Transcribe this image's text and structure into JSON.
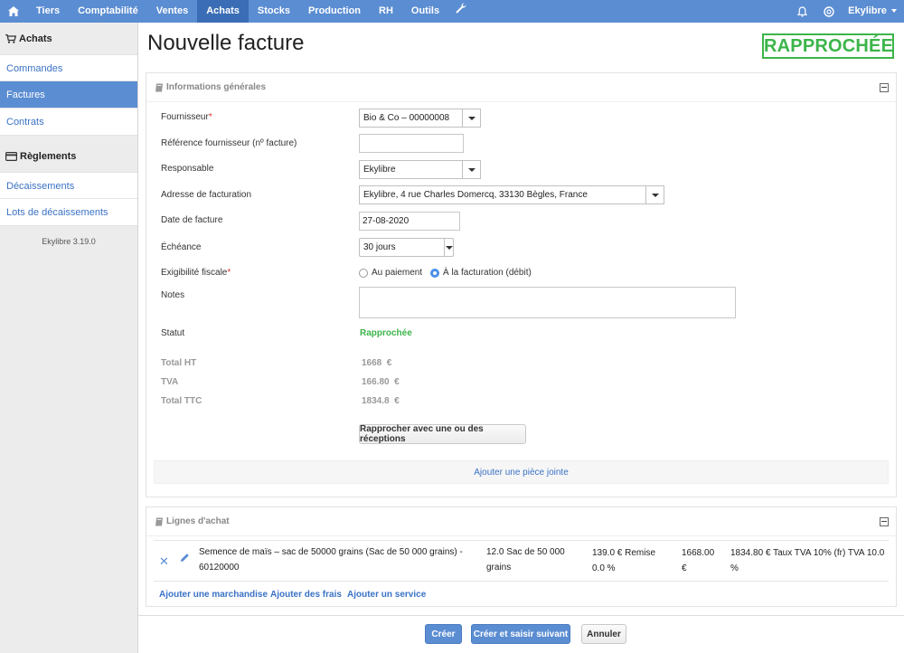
{
  "nav": {
    "items": [
      "Tiers",
      "Comptabilité",
      "Ventes",
      "Achats",
      "Stocks",
      "Production",
      "RH",
      "Outils"
    ],
    "user": "Ekylibre"
  },
  "sidebar": {
    "section_purchases": "Achats",
    "purchases_items": [
      "Commandes",
      "Factures",
      "Contrats"
    ],
    "section_payments": "Règlements",
    "payments_items": [
      "Décaissements",
      "Lots de décaissements"
    ],
    "version": "Ekylibre 3.19.0"
  },
  "page": {
    "title": "Nouvelle facture",
    "status_stamp": "RAPPROCHÉE"
  },
  "general": {
    "heading": "Informations générales",
    "supplier_label": "Fournisseur",
    "supplier_value": "Bio & Co – 00000008",
    "reference_label": "Référence fournisseur (nº facture)",
    "reference_value": "",
    "responsible_label": "Responsable",
    "responsible_value": "Ekylibre",
    "address_label": "Adresse de facturation",
    "address_value": "Ekylibre, 4 rue Charles Domercq, 33130 Bègles, France",
    "date_label": "Date de facture",
    "date_value": "27-08-2020",
    "due_label": "Échéance",
    "due_value": "30 jours",
    "tax_label": "Exigibilité fiscale",
    "tax_option_payment": "Au paiement",
    "tax_option_invoice": "À la facturation (débit)",
    "notes_label": "Notes",
    "status_label": "Statut",
    "status_value": "Rapprochée",
    "total_ht_label": "Total HT",
    "total_ht_value": "1668  €",
    "tva_label": "TVA",
    "tva_value": "166.80  €",
    "total_ttc_label": "Total TTC",
    "total_ttc_value": "1834.8  €",
    "reconcile_button": "Rapprocher avec une ou des réceptions",
    "attach_link": "Ajouter une pièce jointe"
  },
  "lines": {
    "heading": "Lignes d'achat",
    "row": {
      "product": "Semence de maïs – sac de 50000 grains (Sac de 50 000 grains) - 60120000",
      "quantity": "12.0 Sac de 50 000 grains",
      "price": "139.0 € Remise 0.0 %",
      "amount": "1668.00 €",
      "tax": "1834.80 € Taux TVA 10% (fr) TVA 10.0 %"
    },
    "add_goods": "Ajouter une marchandise",
    "add_fees": "Ajouter des frais",
    "add_service": "Ajouter un service"
  },
  "footer": {
    "create": "Créer",
    "create_next": "Créer et saisir suivant",
    "cancel": "Annuler"
  }
}
